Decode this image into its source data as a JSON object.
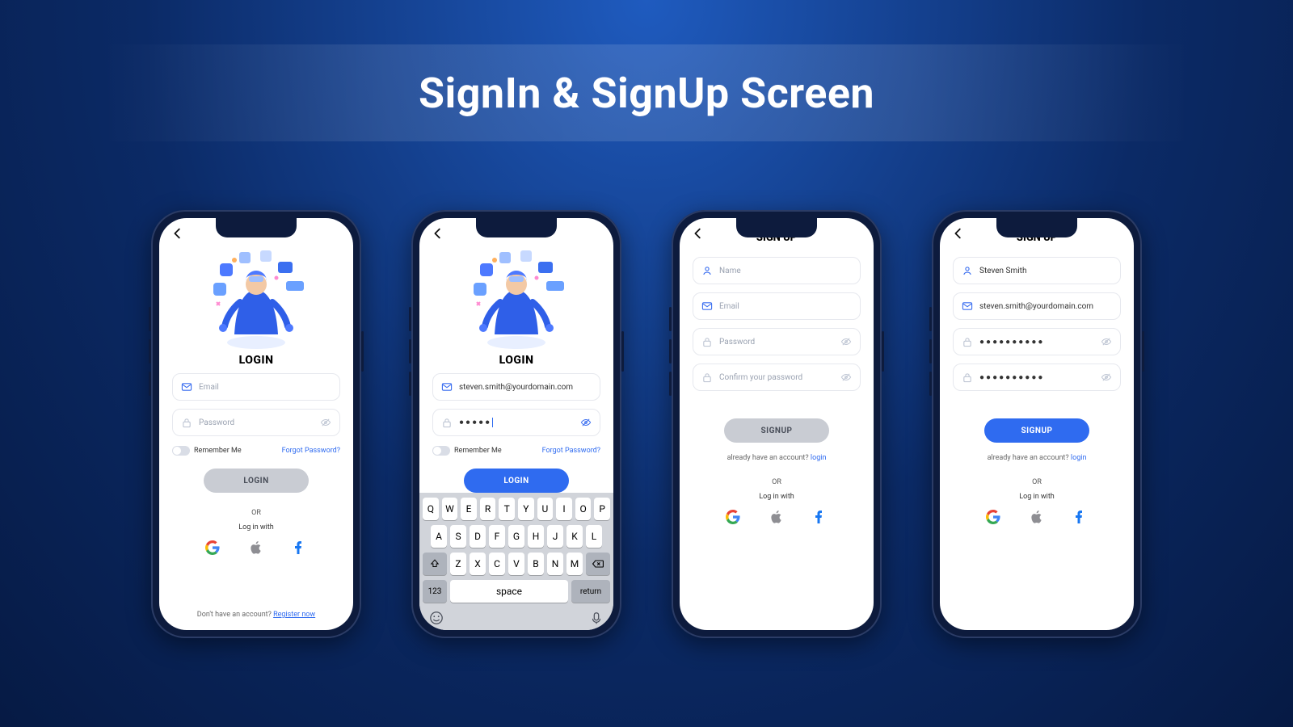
{
  "page_title": "SignIn & SignUp Screen",
  "common": {
    "or": "OR",
    "login_with": "Log in with"
  },
  "login": {
    "heading": "LOGIN",
    "email_ph": "Email",
    "password_ph": "Password",
    "remember": "Remember Me",
    "forgot": "Forgot Password?",
    "button": "LOGIN",
    "footer_pre": "Don't have an account? ",
    "footer_link": "Register now"
  },
  "login_filled": {
    "email_value": "steven.smith@yourdomain.com",
    "password_value": "●●●●●"
  },
  "signup": {
    "heading": "SIGN UP",
    "name_ph": "Name",
    "email_ph": "Email",
    "password_ph": "Password",
    "confirm_ph": "Confirm your password",
    "button": "SIGNUP",
    "footer_pre": "already have an account? ",
    "footer_link": "login"
  },
  "signup_filled": {
    "name_value": "Steven Smith",
    "email_value": "steven.smith@yourdomain.com",
    "password_value": "●●●●●●●●●●",
    "confirm_value": "●●●●●●●●●●"
  },
  "keyboard": {
    "row1": [
      "Q",
      "W",
      "E",
      "R",
      "T",
      "Y",
      "U",
      "I",
      "O",
      "P"
    ],
    "row2": [
      "A",
      "S",
      "D",
      "F",
      "G",
      "H",
      "J",
      "K",
      "L"
    ],
    "row3": [
      "Z",
      "X",
      "C",
      "V",
      "B",
      "N",
      "M"
    ],
    "num": "123",
    "space": "space",
    "return": "return"
  }
}
